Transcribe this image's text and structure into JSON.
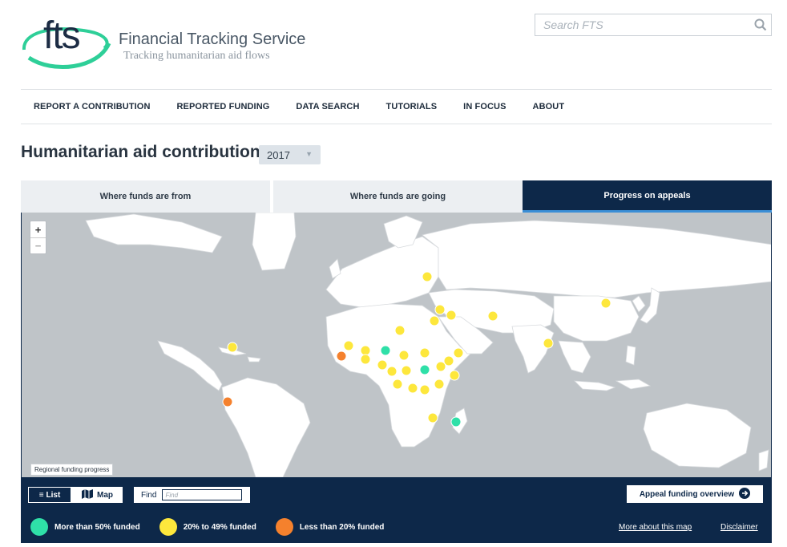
{
  "header": {
    "logo_text": "fts",
    "brand_name": "Financial Tracking Service",
    "brand_tagline": "Tracking humanitarian aid flows",
    "search": {
      "placeholder": "Search FTS",
      "icon": "search-icon"
    }
  },
  "nav": {
    "items": [
      {
        "label": "REPORT A CONTRIBUTION"
      },
      {
        "label": "REPORTED FUNDING"
      },
      {
        "label": "DATA SEARCH"
      },
      {
        "label": "TUTORIALS"
      },
      {
        "label": "IN FOCUS"
      },
      {
        "label": "ABOUT"
      }
    ]
  },
  "main": {
    "title": "Humanitarian aid contributions",
    "year_select": {
      "value": "2017"
    },
    "tabs": [
      {
        "label": "Where funds are from",
        "active": false
      },
      {
        "label": "Where funds are going",
        "active": false
      },
      {
        "label": "Progress on appeals",
        "active": true
      }
    ]
  },
  "map": {
    "zoom_in": "+",
    "zoom_out": "−",
    "region_label": "Regional funding progress",
    "colors": {
      "high": "#2fe0a8",
      "mid": "#fde73c",
      "low": "#f5812d",
      "land": "#ffffff",
      "water": "#bfc4c8"
    }
  },
  "controls": {
    "list_label": "List",
    "map_label": "Map",
    "find_label": "Find",
    "find_placeholder": "Find",
    "overview_label": "Appeal funding overview",
    "more_link": "More about this map",
    "disclaimer_link": "Disclaimer"
  },
  "legend": [
    {
      "label": "More than 50% funded",
      "color": "#2fe0a8"
    },
    {
      "label": "20% to 49% funded",
      "color": "#fde73c"
    },
    {
      "label": "Less than 20% funded",
      "color": "#f5812d"
    }
  ],
  "colors": {
    "navy": "#0d2849",
    "accent": "#3a8ed6"
  }
}
